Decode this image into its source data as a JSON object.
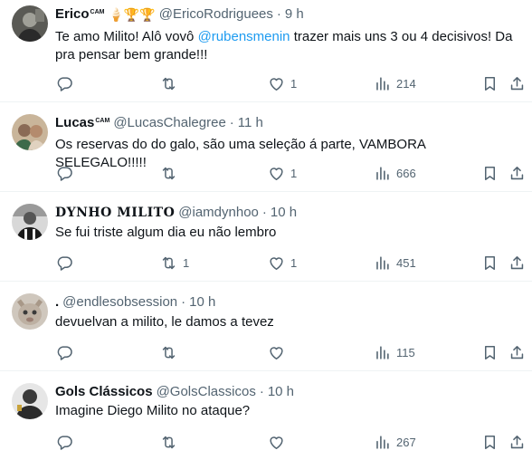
{
  "colors": {
    "text": "#0f1419",
    "secondary": "#536471",
    "link": "#1d9bf0",
    "divider": "#eff3f4"
  },
  "icons": {
    "reply": "speech-bubble",
    "retweet": "loop-arrows",
    "like": "heart",
    "views": "bar-chart",
    "bookmark": "bookmark",
    "share": "upload-arrow"
  },
  "tweets": [
    {
      "name": "Erico",
      "name_sup": "CAM",
      "badges": "🍦🏆🏆",
      "handle": "@EricoRodriguees",
      "dot": "·",
      "time": "9 h",
      "text_before": "Te amo Milito! Alô vovô ",
      "mention": "@rubensmenin",
      "text_after": " trazer mais uns 3 ou 4 decisivos! Da pra pensar bem grande!!!",
      "replies": "",
      "retweets": "",
      "likes": "1",
      "views": "214"
    },
    {
      "name": "Lucas",
      "name_sup": "CAM",
      "handle": "@LucasChalegree",
      "dot": "·",
      "time": "11 h",
      "text": "Os reservas do do galo, são uma seleção á parte, VAMBORA SELEGALO!!!!!",
      "replies": "",
      "retweets": "",
      "likes": "1",
      "views": "666"
    },
    {
      "name": "DYNHO MILITO",
      "handle": "@iamdynhoo",
      "dot": "·",
      "time": "10 h",
      "text": "Se fui triste algum dia eu não lembro",
      "replies": "",
      "retweets": "1",
      "likes": "1",
      "views": "451"
    },
    {
      "name": ".",
      "handle": "@endlesobsession",
      "dot": "·",
      "time": "10 h",
      "text": "devuelvan a milito, le damos a tevez",
      "replies": "",
      "retweets": "",
      "likes": "",
      "views": "115"
    },
    {
      "name": "Gols Clássicos",
      "handle": "@GolsClassicos",
      "dot": "·",
      "time": "10 h",
      "text": "Imagine Diego Milito no ataque?",
      "replies": "",
      "retweets": "",
      "likes": "",
      "views": "267"
    }
  ]
}
